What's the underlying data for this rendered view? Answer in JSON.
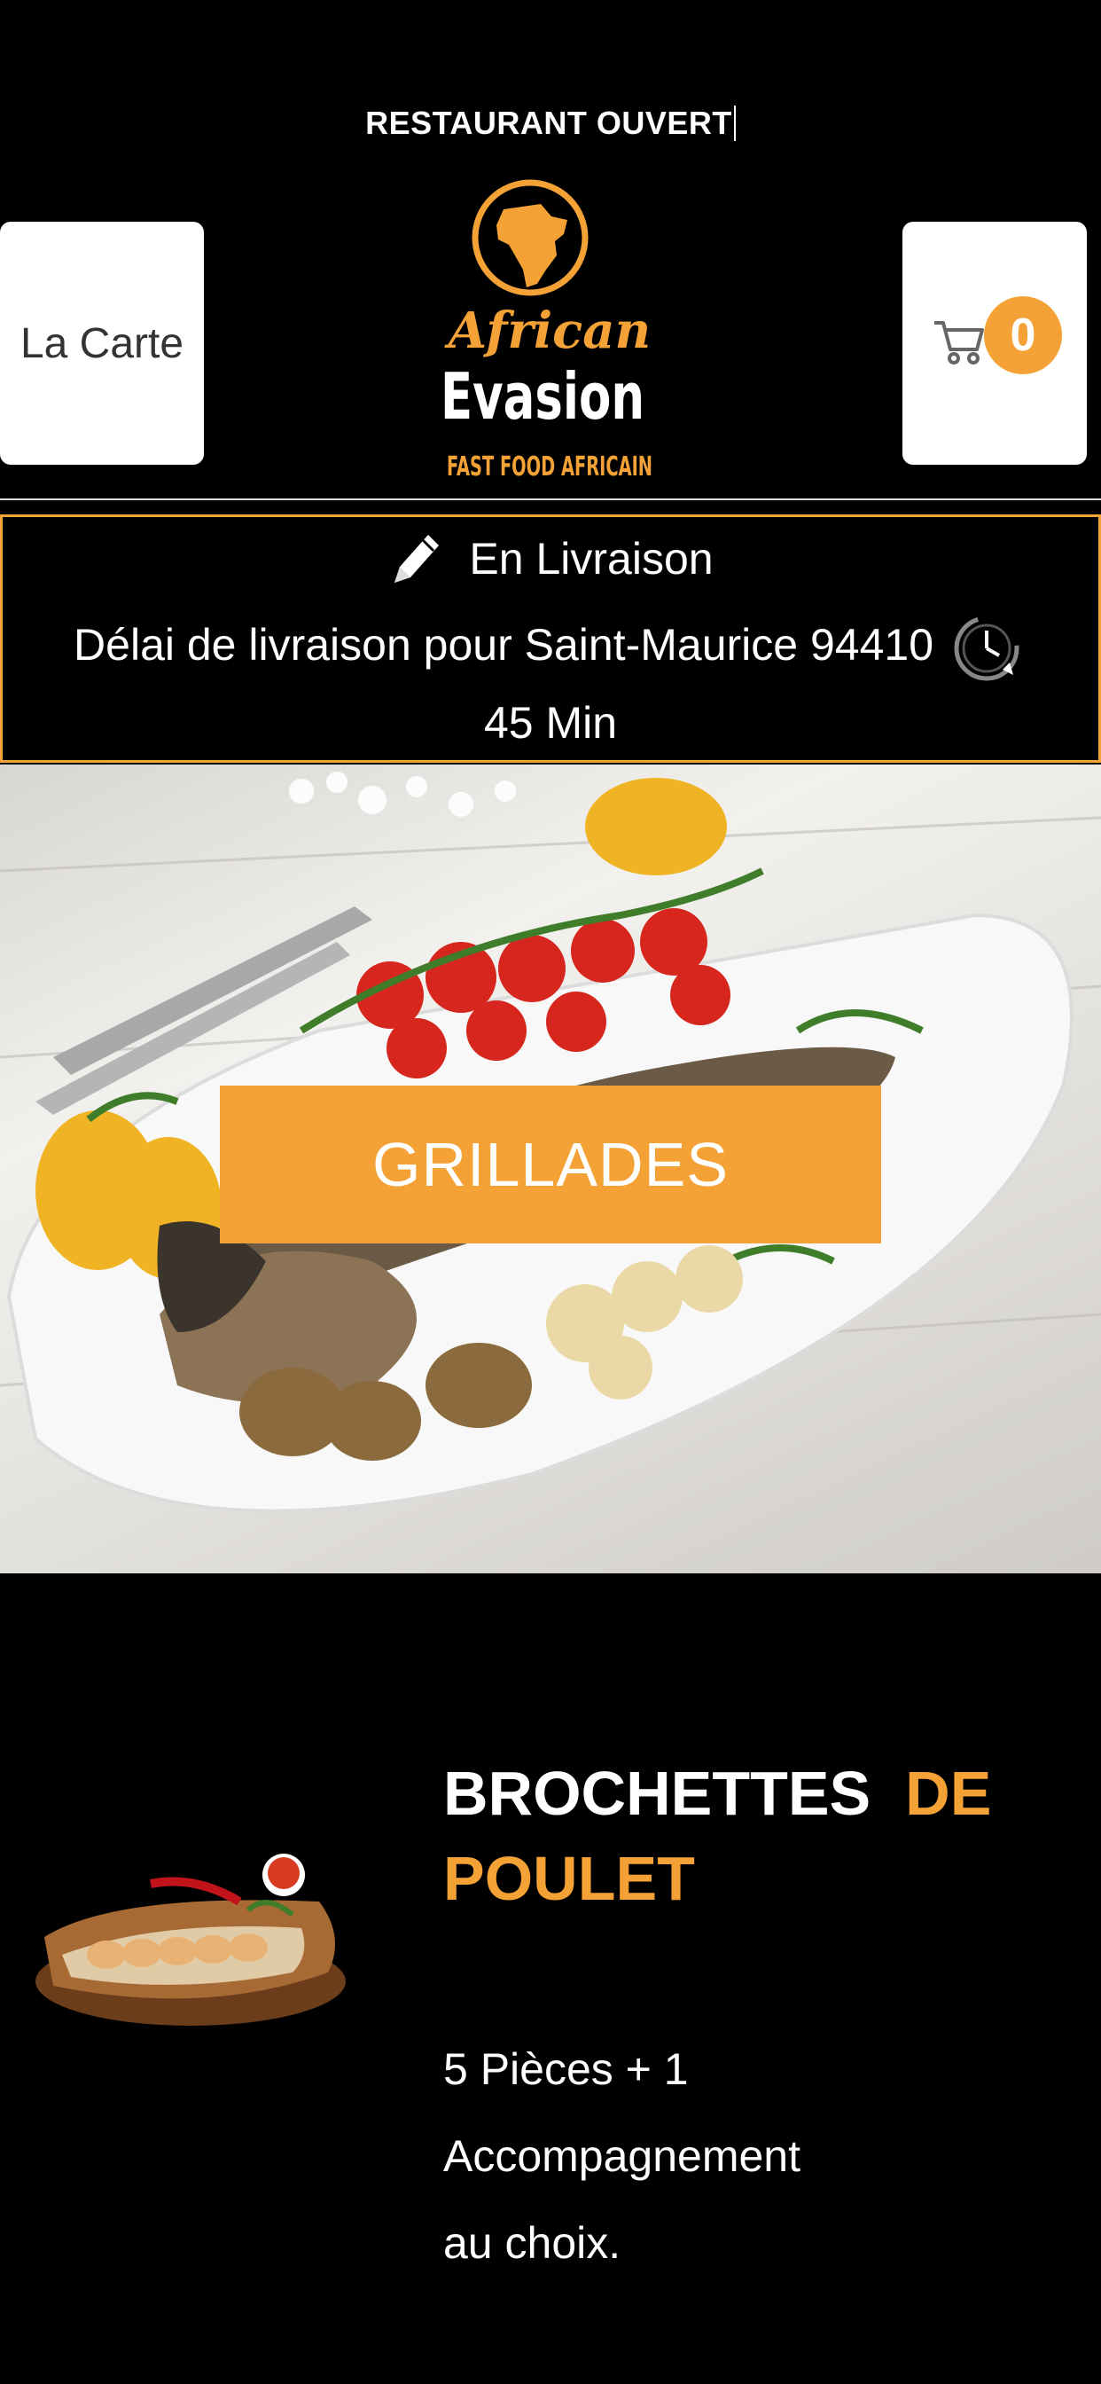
{
  "header": {
    "status_text": "RESTAURANT OUVERT",
    "menu_button_label": "La Carte",
    "logo": {
      "line1": "African",
      "line2": "Evasion",
      "tagline": "FAST FOOD AFRICAIN"
    },
    "cart_count": "0"
  },
  "delivery": {
    "mode_label": "En Livraison",
    "delay_text": "Délai de livraison pour Saint-Maurice 94410",
    "delay_value": "45",
    "delay_unit": "Min"
  },
  "category": {
    "label": "GRILLADES"
  },
  "product": {
    "title_part1": "BROCHETTES",
    "title_part2": "DE POULET",
    "description": "5 Pièces  + 1 Accompagnement au choix."
  },
  "colors": {
    "accent": "#f4a236",
    "background": "#000000"
  },
  "icons": {
    "edit": "pencil-icon",
    "clock": "clock-icon",
    "cart": "cart-icon"
  }
}
